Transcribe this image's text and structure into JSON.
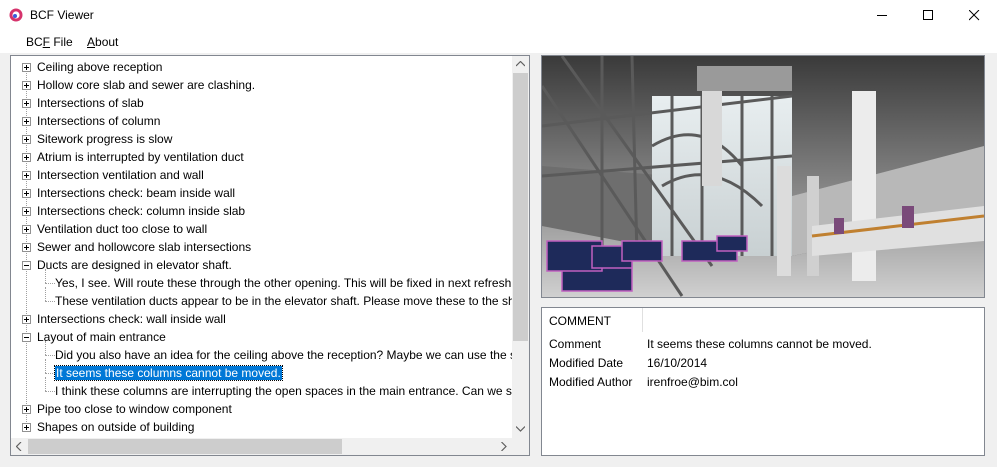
{
  "window": {
    "title": "BCF Viewer"
  },
  "menu": {
    "file": "BCF File",
    "file_accel": "F",
    "about": "About",
    "about_accel": "A"
  },
  "tree": {
    "topics": [
      "Ceiling above reception",
      "Hollow core slab and sewer are clashing.",
      "Intersections of slab",
      "Intersections of column",
      "Sitework progress is slow",
      "Atrium is interrupted by ventilation duct",
      "Intersection ventilation and wall",
      "Intersections check: beam inside wall",
      "Intersections check: column inside slab",
      "Ventilation duct too close to wall",
      "Sewer and hollowcore slab intersections",
      "Ducts are designed in elevator shaft.",
      "Intersections check: wall inside wall",
      "Layout of main entrance",
      "Pipe too close to window component",
      "Shapes on outside of building"
    ],
    "ducts_comments": [
      "Yes, I see. Will route these through the other opening. This will be fixed in next refresh round.",
      "These ventilation ducts appear to be in the elevator shaft. Please move these to the shaft next door."
    ],
    "layout_comments": [
      "Did you also have an idea for the ceiling above the reception? Maybe we can use the same panels.",
      "It seems these columns cannot be moved.",
      "I think these columns are interrupting the open spaces in the main entrance. Can we see if they can be moved?"
    ]
  },
  "properties": {
    "header": "COMMENT",
    "comment_label": "Comment",
    "comment_value": "It seems these columns cannot be moved.",
    "date_label": "Modified Date",
    "date_value": "16/10/2014",
    "author_label": "Modified Author",
    "author_value": "irenfroe@bim.col"
  },
  "colors": {
    "selection": "#0078d7",
    "accent_logo": "#d6336c"
  }
}
